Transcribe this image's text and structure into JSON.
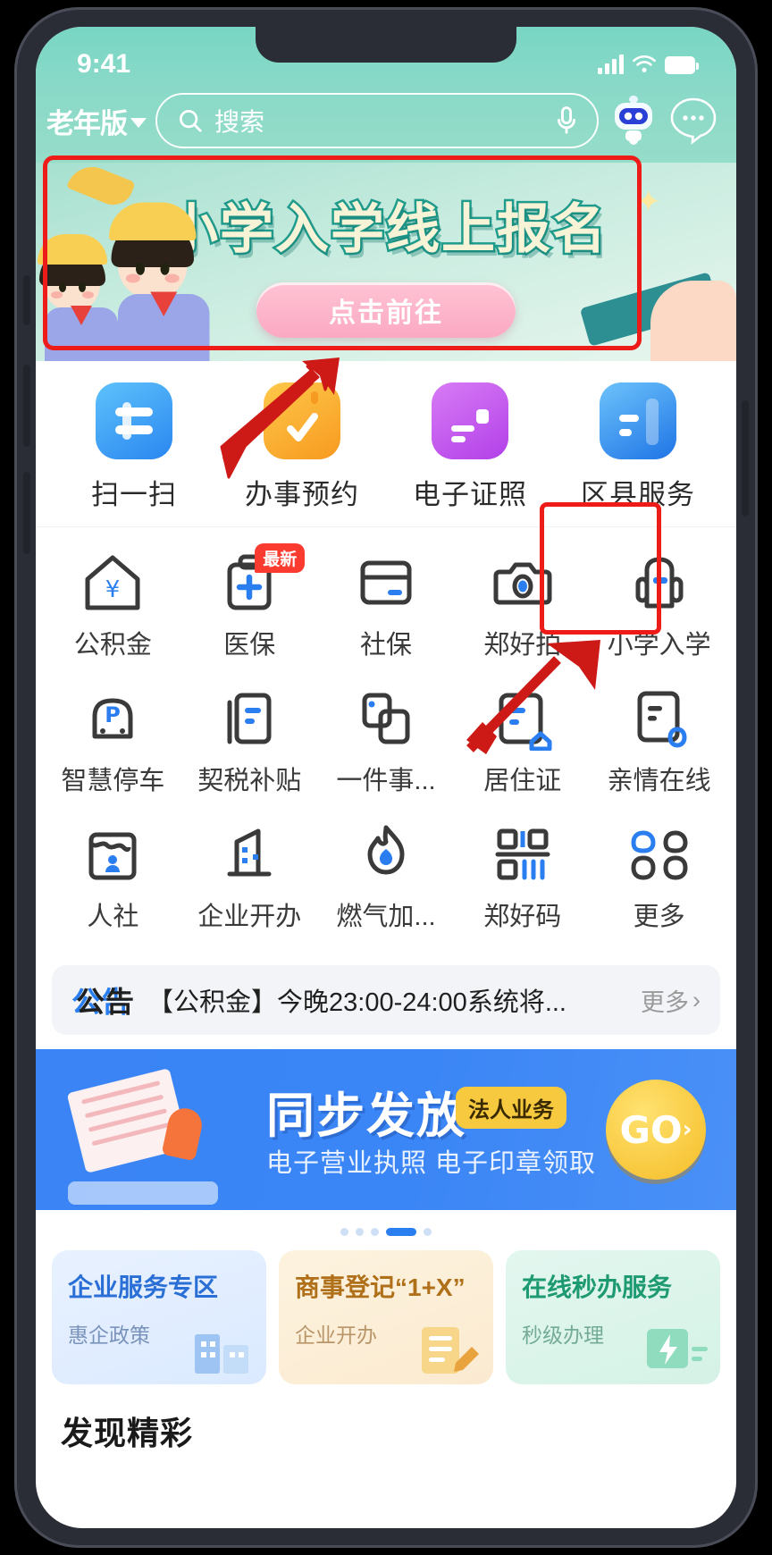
{
  "status_bar": {
    "time": "9:41",
    "signal_icon": "signal-bars-icon",
    "wifi_icon": "wifi-icon",
    "battery_icon": "battery-icon"
  },
  "header": {
    "version_switch": "老年版",
    "version_caret_icon": "chevron-down-icon",
    "search_placeholder": "搜索",
    "search_icon": "search-icon",
    "mic_icon": "microphone-icon",
    "assistant_icon": "robot-assistant-icon",
    "more_icon": "more-dots-icon"
  },
  "hero": {
    "title": "小学入学线上报名",
    "cta_label": "点击前往"
  },
  "quick_actions": [
    {
      "label": "扫一扫",
      "icon": "scan-icon",
      "color": "#3aa0f3"
    },
    {
      "label": "办事预约",
      "icon": "calendar-check-icon",
      "color": "#f8a82a"
    },
    {
      "label": "电子证照",
      "icon": "id-card-icon",
      "color": "#c454e8"
    },
    {
      "label": "区县服务",
      "icon": "district-service-icon",
      "color": "#2a84ea"
    }
  ],
  "services": [
    {
      "label": "公积金",
      "icon": "house-yuan-icon",
      "badge": ""
    },
    {
      "label": "医保",
      "icon": "medical-clipboard-icon",
      "badge": "最新"
    },
    {
      "label": "社保",
      "icon": "social-card-icon",
      "badge": ""
    },
    {
      "label": "郑好拍",
      "icon": "camera-icon",
      "badge": ""
    },
    {
      "label": "小学入学",
      "icon": "backpack-icon",
      "badge": ""
    },
    {
      "label": "智慧停车",
      "icon": "parking-car-icon",
      "badge": ""
    },
    {
      "label": "契税补贴",
      "icon": "tax-document-icon",
      "badge": ""
    },
    {
      "label": "一件事...",
      "icon": "stacked-pages-icon",
      "badge": ""
    },
    {
      "label": "居住证",
      "icon": "residence-permit-icon",
      "badge": ""
    },
    {
      "label": "亲情在线",
      "icon": "family-online-icon",
      "badge": ""
    },
    {
      "label": "人社",
      "icon": "person-service-icon",
      "badge": ""
    },
    {
      "label": "企业开办",
      "icon": "building-icon",
      "badge": ""
    },
    {
      "label": "燃气加...",
      "icon": "gas-flame-icon",
      "badge": ""
    },
    {
      "label": "郑好码",
      "icon": "qr-code-icon",
      "badge": ""
    },
    {
      "label": "更多",
      "icon": "grid-more-icon",
      "badge": ""
    }
  ],
  "announcement": {
    "tag": "公告",
    "text": "【公积金】今晚23:00-24:00系统将...",
    "more_label": "更多",
    "more_icon": "chevron-right-icon"
  },
  "promo_banner": {
    "title": "同步发放",
    "chip": "法人业务",
    "subtitle": "电子营业执照 电子印章领取",
    "go_label": "GO",
    "go_icon": "chevron-right-icon"
  },
  "carousel": {
    "dot_count": 5,
    "active_index": 3
  },
  "bottom_cards": [
    {
      "title": "企业服务专区",
      "subtitle": "惠企政策",
      "art_icon": "office-building-icon"
    },
    {
      "title": "商事登记“1+X”",
      "subtitle": "企业开办",
      "art_icon": "notepad-pencil-icon"
    },
    {
      "title": "在线秒办服务",
      "subtitle": "秒级办理",
      "art_icon": "lightning-bolt-icon"
    }
  ],
  "footer": {
    "teaser": "发现精彩"
  },
  "annotations": {
    "box_hero": "highlight-hero-banner",
    "box_service": "highlight-xiaoxue-service",
    "arrow_scan": "arrow-pointing-to-hero",
    "arrow_service": "arrow-pointing-to-xiaoxue",
    "color": "#ee1c19"
  },
  "colors": {
    "brand_green": "#8ad9c8",
    "brand_blue": "#2a7ef0",
    "accent_red": "#fb3b30",
    "accent_yellow": "#f6c93f"
  }
}
